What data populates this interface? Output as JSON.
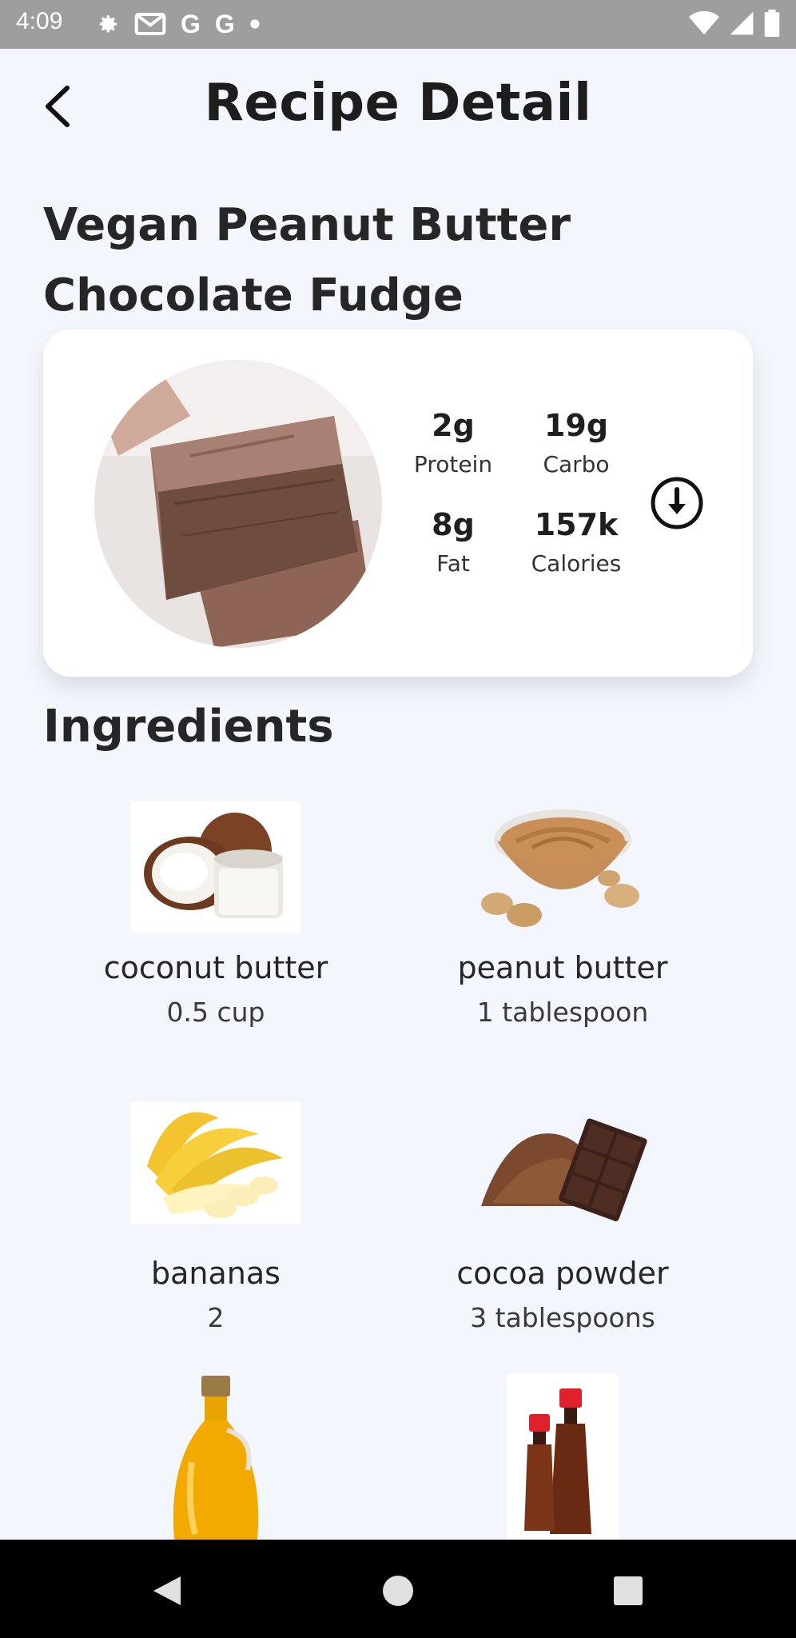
{
  "status_bar": {
    "time": "4:09",
    "left_icons": [
      "gear-icon",
      "gmail-icon",
      "google-icon",
      "google-icon",
      "dot-icon"
    ],
    "right_icons": [
      "wifi-icon",
      "signal-icon",
      "battery-icon"
    ]
  },
  "header": {
    "title": "Recipe Detail"
  },
  "recipe": {
    "title": "Vegan Peanut Butter Chocolate Fudge"
  },
  "nutrition": [
    {
      "value": "2g",
      "label": "Protein"
    },
    {
      "value": "19g",
      "label": "Carbo"
    },
    {
      "value": "8g",
      "label": "Fat"
    },
    {
      "value": "157k",
      "label": "Calories"
    }
  ],
  "ingredients_title": "Ingredients",
  "ingredients": [
    {
      "name": "coconut butter",
      "amount": "0.5 cup"
    },
    {
      "name": "peanut butter",
      "amount": "1 tablespoon"
    },
    {
      "name": "bananas",
      "amount": "2"
    },
    {
      "name": "cocoa powder",
      "amount": "3 tablespoons"
    },
    {
      "name": "",
      "amount": ""
    },
    {
      "name": "",
      "amount": ""
    }
  ],
  "colors": {
    "background": "#f4f6fd",
    "card": "#ffffff",
    "status_bar": "#9e9e9e",
    "nav_bar": "#000000",
    "text": "#262626"
  }
}
